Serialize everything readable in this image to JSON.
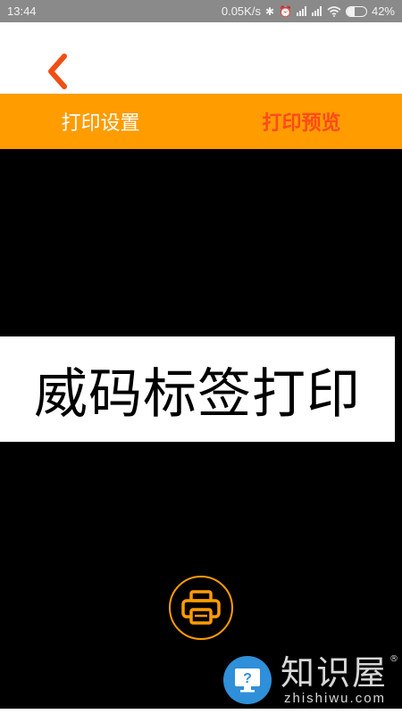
{
  "status_bar": {
    "time": "13:44",
    "network_speed": "0.05K/s",
    "battery_percent": "42%",
    "battery_level": 0.42,
    "icons": [
      "bluetooth-icon",
      "alarm-icon",
      "signal-icon",
      "signal-icon",
      "wifi-icon",
      "battery-icon"
    ]
  },
  "header": {
    "back_icon": "chevron-left-icon"
  },
  "tabs": [
    {
      "label": "打印设置",
      "active": false
    },
    {
      "label": "打印预览",
      "active": true
    }
  ],
  "preview": {
    "label_text": "威码标签打印"
  },
  "print_button": {
    "icon": "printer-icon"
  },
  "watermark": {
    "cn": "知识屋",
    "en": "zhishiwu.com",
    "reg": "®",
    "icon": "question-monitor-icon"
  },
  "colors": {
    "accent": "#ff9c00",
    "active_tab": "#ff4a1a",
    "status_bar": "#8a8a8a",
    "logo": "#2f8fd8"
  }
}
